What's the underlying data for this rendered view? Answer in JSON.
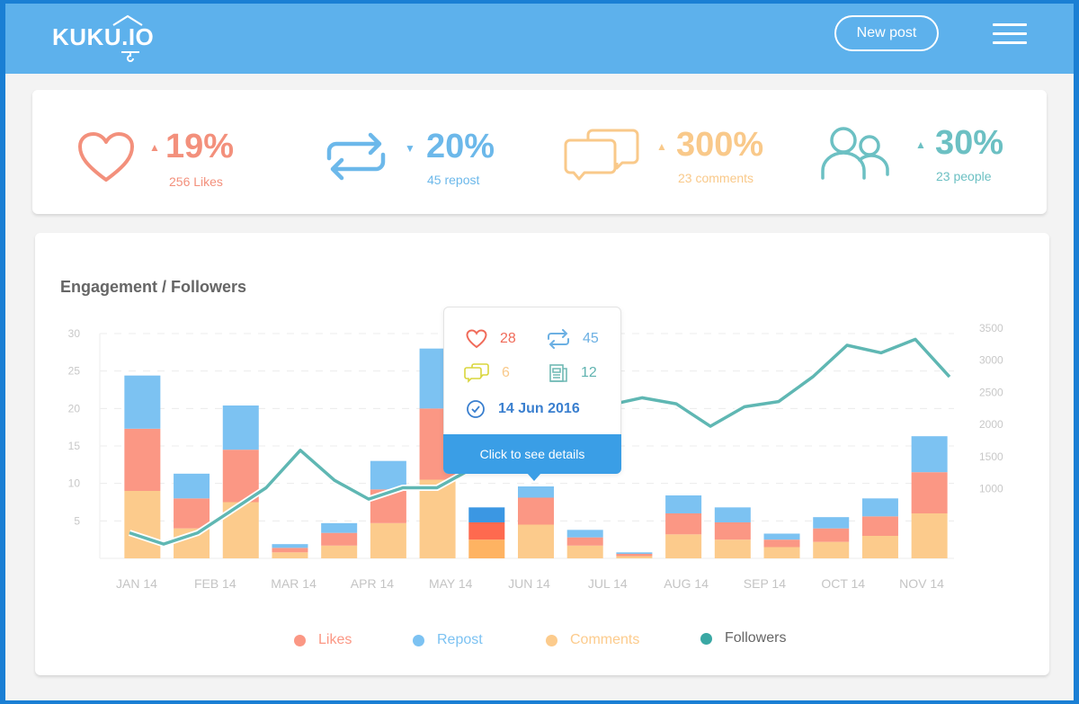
{
  "header": {
    "logo": "KUKU.IO",
    "new_post_label": "New post",
    "menu_icon": "hamburger-menu-icon"
  },
  "stats": [
    {
      "icon": "heart-icon",
      "trend": "up",
      "percent": "19%",
      "label": "256 Likes",
      "color": "#f3907c"
    },
    {
      "icon": "repost-icon",
      "trend": "down",
      "percent": "20%",
      "label": "45 repost",
      "color": "#6cb8ea"
    },
    {
      "icon": "comments-icon",
      "trend": "up",
      "percent": "300%",
      "label": "23 comments",
      "color": "#f9c98a"
    },
    {
      "icon": "people-icon",
      "trend": "up",
      "percent": "30%",
      "label": "23 people",
      "color": "#6cc0c3"
    }
  ],
  "chart_card": {
    "title": "Engagement / Followers",
    "tooltip": {
      "likes": "28",
      "reposts": "45",
      "comments": "6",
      "posts": "12",
      "date": "14 Jun 2016",
      "action_label": "Click to see details"
    }
  },
  "colors": {
    "likes": "#fb9784",
    "repost": "#7cc2f2",
    "comments": "#fccb8c",
    "followers": "#5fb7b3",
    "likes_hl": "#fe6a4f",
    "repost_hl": "#3b97e3",
    "comments_hl": "#feb362",
    "accent": "#3a9ee6"
  },
  "chart_data": {
    "type": "bar",
    "title": "Engagement / Followers",
    "xlabel": "",
    "ylabel": "",
    "categories": [
      "JAN 14",
      "FEB 14",
      "MAR 14",
      "APR 14",
      "MAY 14",
      "JUN 14",
      "JUL 14",
      "AUG 14",
      "SEP 14",
      "OCT 14",
      "NOV 14"
    ],
    "bar_slots": 17,
    "series": [
      {
        "name": "Comments",
        "type": "bar",
        "stack": "engagement",
        "values": [
          9,
          4,
          7.5,
          0.8,
          1.7,
          4.7,
          10.5,
          2.5,
          4.5,
          1.7,
          0.3,
          3.2,
          2.5,
          1.5,
          2.2,
          3,
          6
        ]
      },
      {
        "name": "Likes",
        "type": "bar",
        "stack": "engagement",
        "values": [
          8.3,
          4,
          7,
          0.6,
          1.7,
          4.5,
          9.5,
          2.3,
          3.6,
          1.1,
          0.3,
          2.8,
          2.3,
          1,
          1.8,
          2.6,
          5.5
        ]
      },
      {
        "name": "Repost",
        "type": "bar",
        "stack": "engagement",
        "values": [
          7.1,
          3.3,
          5.9,
          0.5,
          1.3,
          3.8,
          8,
          2,
          1.5,
          1,
          0.2,
          2.4,
          2,
          0.8,
          1.5,
          2.4,
          4.8
        ]
      },
      {
        "name": "Followers",
        "type": "line",
        "axis": "right",
        "values": [
          700,
          550,
          700,
          1000,
          1300,
          1800,
          1400,
          1150,
          1300,
          1300,
          1550,
          1900,
          2200,
          2450,
          2400,
          2500,
          2420,
          2120,
          2380,
          2450,
          2780,
          3200,
          3100,
          3280,
          2780
        ]
      }
    ],
    "highlighted_bar": 7,
    "y_left": {
      "ticks": [
        5,
        10,
        15,
        20,
        25,
        30
      ],
      "ylim": [
        0,
        30
      ]
    },
    "y_right": {
      "ticks": [
        1000,
        1500,
        2000,
        2500,
        3000,
        3500
      ],
      "ylim": [
        0,
        3500
      ]
    },
    "grid": true,
    "legend": {
      "position": "bottom",
      "entries": [
        "Likes",
        "Repost",
        "Comments",
        "Followers"
      ]
    }
  }
}
